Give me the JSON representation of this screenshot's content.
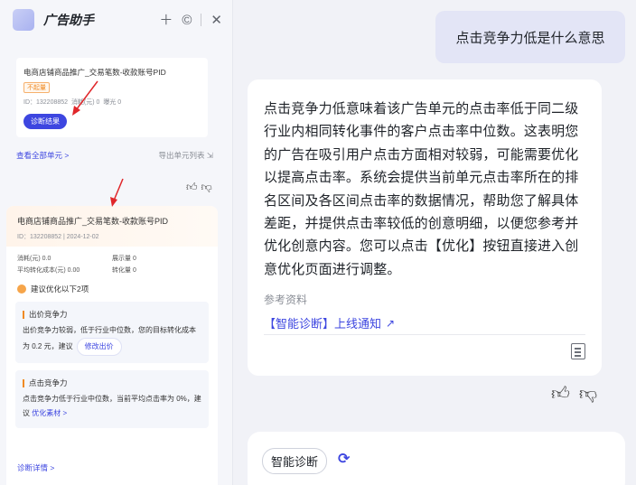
{
  "app": {
    "title": "广告助手"
  },
  "toolbar": {
    "add_icon": "plus-icon",
    "history_icon": "history-icon",
    "close_icon": "close-icon"
  },
  "card1": {
    "name": "电商店铺商品推广_交易笔数-收款账号PID",
    "badge": "不起量",
    "id_text": "ID：132208852",
    "cost_label": "消耗(元) 0",
    "exposure_label": "曝光 0",
    "button": "诊断结果"
  },
  "links": {
    "view_all": "查看全部单元 >",
    "export": "导出单元列表"
  },
  "card2": {
    "name": "电商店铺商品推广_交易笔数-收款账号PID",
    "id_date": "ID：132208852 | 2024-12-02",
    "stats": [
      "消耗(元) 0.0",
      "展示量 0",
      "平均转化成本(元) 0.00",
      "转化量 0"
    ],
    "suggest": "建议优化以下2项",
    "blocks": [
      {
        "title": "出价竞争力",
        "text": "出价竞争力较弱，低于行业中位数，您的目标转化成本为 0.2 元，建议",
        "action": "修改出价"
      },
      {
        "title": "点击竞争力",
        "text": "点击竞争力低于行业中位数，当前平均点击率为 0%，建议",
        "action": "优化素材 >"
      }
    ],
    "detail_link": "诊断详情 >"
  },
  "chat": {
    "question": "点击竞争力低是什么意思",
    "answer": "点击竞争力低意味着该广告单元的点击率低于同二级行业内相同转化事件的客户点击率中位数。这表明您的广告在吸引用户点击方面相对较弱，可能需要优化以提高点击率。系统会提供当前单元点击率所在的排名区间及各区间点击率的数据情况，帮助您了解具体差距，并提供点击率较低的创意明细，以便您参考并优化创意内容。您可以点击【优化】按钮直接进入创意优化页面进行调整。",
    "ref_label": "参考资料",
    "ref_link": "【智能诊断】上线通知"
  },
  "composer": {
    "tool_chip": "智能诊断"
  },
  "colors": {
    "accent": "#3d46e0",
    "warning": "#f08a24",
    "annotation_arrow": "#e0262a"
  }
}
